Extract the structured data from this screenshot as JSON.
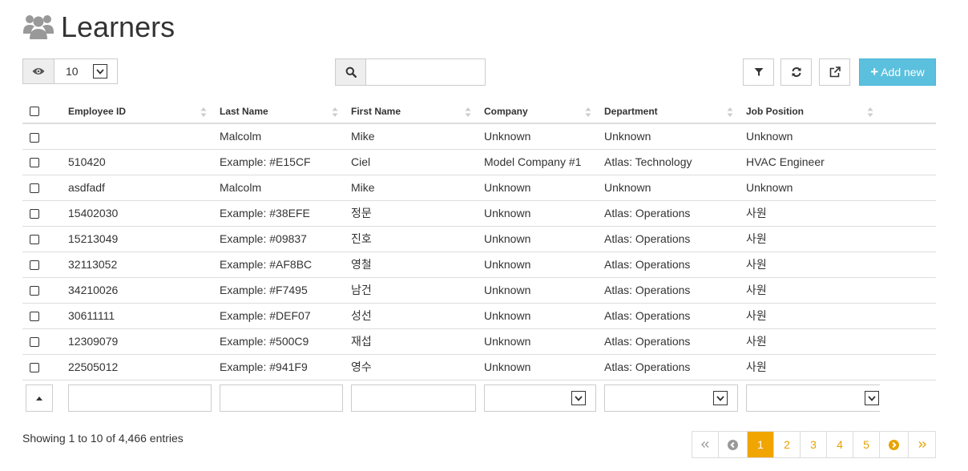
{
  "header": {
    "title": "Learners",
    "icon": "users-icon"
  },
  "toolbar": {
    "page_size": "10",
    "search_placeholder": "",
    "add_label": "Add new"
  },
  "table": {
    "columns": [
      "Employee ID",
      "Last Name",
      "First Name",
      "Company",
      "Department",
      "Job Position"
    ],
    "rows": [
      [
        "",
        "Malcolm",
        "Mike",
        "Unknown",
        "Unknown",
        "Unknown"
      ],
      [
        "510420",
        "Example: #E15CF",
        "Ciel",
        "Model Company #1",
        "Atlas: Technology",
        "HVAC Engineer"
      ],
      [
        "asdfadf",
        "Malcolm",
        "Mike",
        "Unknown",
        "Unknown",
        "Unknown"
      ],
      [
        "15402030",
        "Example: #38EFE",
        "정문",
        "Unknown",
        "Atlas: Operations",
        "사원"
      ],
      [
        "15213049",
        "Example: #09837",
        "진호",
        "Unknown",
        "Atlas: Operations",
        "사원"
      ],
      [
        "32113052",
        "Example: #AF8BC",
        "영철",
        "Unknown",
        "Atlas: Operations",
        "사원"
      ],
      [
        "34210026",
        "Example: #F7495",
        "남건",
        "Unknown",
        "Atlas: Operations",
        "사원"
      ],
      [
        "30611111",
        "Example: #DEF07",
        "성선",
        "Unknown",
        "Atlas: Operations",
        "사원"
      ],
      [
        "12309079",
        "Example: #500C9",
        "재섭",
        "Unknown",
        "Atlas: Operations",
        "사원"
      ],
      [
        "22505012",
        "Example: #941F9",
        "영수",
        "Unknown",
        "Atlas: Operations",
        "사원"
      ]
    ]
  },
  "footer": {
    "info": "Showing 1 to 10 of 4,466 entries",
    "pages": [
      "1",
      "2",
      "3",
      "4",
      "5"
    ],
    "current_page": "1"
  },
  "colors": {
    "accent": "#5bc0de",
    "pager": "#f0a500"
  }
}
